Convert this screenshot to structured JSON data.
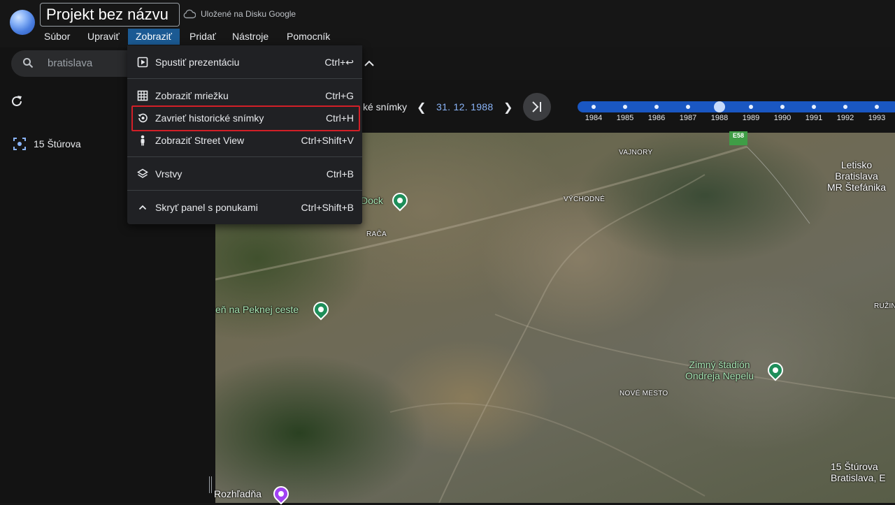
{
  "app": {
    "project_title": "Projekt bez názvu",
    "save_status": "Uložené na Disku Google"
  },
  "menubar": {
    "items": [
      "Súbor",
      "Upraviť",
      "Zobraziť",
      "Pridať",
      "Nástroje",
      "Pomocník"
    ],
    "active": "Zobraziť"
  },
  "search": {
    "value": "bratislava"
  },
  "sidebar": {
    "places": [
      {
        "label": "15 Štúrova"
      }
    ]
  },
  "dropdown": {
    "items": [
      {
        "label": "Spustiť prezentáciu",
        "shortcut": "Ctrl+↩",
        "icon": "play-icon"
      },
      {
        "label": "Zobraziť mriežku",
        "shortcut": "Ctrl+G",
        "icon": "grid-icon"
      },
      {
        "label": "Zavrieť historické snímky",
        "shortcut": "Ctrl+H",
        "icon": "history-icon",
        "highlighted": true
      },
      {
        "label": "Zobraziť Street View",
        "shortcut": "Ctrl+Shift+V",
        "icon": "pegman-icon"
      },
      {
        "label": "Vrstvy",
        "shortcut": "Ctrl+B",
        "icon": "layers-icon"
      },
      {
        "label": "Skryť panel s ponukami",
        "shortcut": "Ctrl+Shift+B",
        "icon": "chevron-up-icon"
      }
    ]
  },
  "timeline": {
    "label_partial": "ké snímky",
    "date": "31. 12. 1988",
    "years": [
      "1984",
      "1985",
      "1986",
      "1987",
      "1988",
      "1989",
      "1990",
      "1991",
      "1992",
      "1993"
    ],
    "selected_year": "1988"
  },
  "map": {
    "labels": {
      "vajnory": "VAJNORY",
      "vychodne": "VÝCHODNÉ",
      "raca": "RAČA",
      "nove_mesto": "NOVÉ MESTO",
      "ruzinov": "RUŽIN",
      "airport": "Letisko\nBratislava\nMR Štefánika",
      "dock": "Dock",
      "peknej": "eň na Peknej ceste",
      "stadion": "Zimný štadión\nOndreja Nepelu",
      "address": "15 Štúrova\nBratislava, E",
      "rozhladna": "Rozhľadňa",
      "road": "E58"
    }
  },
  "colors": {
    "menu_active_bg": "#1b5a93",
    "timeline_slider": "#1a57c2",
    "date_accent": "#8ab4f8",
    "highlight_border": "#d21f27"
  }
}
